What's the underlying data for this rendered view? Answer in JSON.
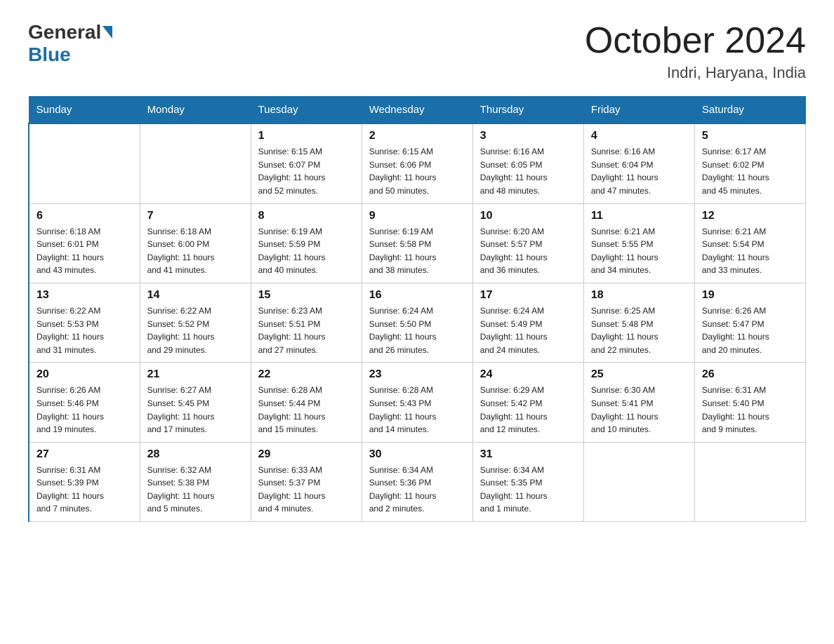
{
  "header": {
    "logo_general": "General",
    "logo_blue": "Blue",
    "month_title": "October 2024",
    "location": "Indri, Haryana, India"
  },
  "weekdays": [
    "Sunday",
    "Monday",
    "Tuesday",
    "Wednesday",
    "Thursday",
    "Friday",
    "Saturday"
  ],
  "weeks": [
    [
      {
        "day": "",
        "info": ""
      },
      {
        "day": "",
        "info": ""
      },
      {
        "day": "1",
        "info": "Sunrise: 6:15 AM\nSunset: 6:07 PM\nDaylight: 11 hours\nand 52 minutes."
      },
      {
        "day": "2",
        "info": "Sunrise: 6:15 AM\nSunset: 6:06 PM\nDaylight: 11 hours\nand 50 minutes."
      },
      {
        "day": "3",
        "info": "Sunrise: 6:16 AM\nSunset: 6:05 PM\nDaylight: 11 hours\nand 48 minutes."
      },
      {
        "day": "4",
        "info": "Sunrise: 6:16 AM\nSunset: 6:04 PM\nDaylight: 11 hours\nand 47 minutes."
      },
      {
        "day": "5",
        "info": "Sunrise: 6:17 AM\nSunset: 6:02 PM\nDaylight: 11 hours\nand 45 minutes."
      }
    ],
    [
      {
        "day": "6",
        "info": "Sunrise: 6:18 AM\nSunset: 6:01 PM\nDaylight: 11 hours\nand 43 minutes."
      },
      {
        "day": "7",
        "info": "Sunrise: 6:18 AM\nSunset: 6:00 PM\nDaylight: 11 hours\nand 41 minutes."
      },
      {
        "day": "8",
        "info": "Sunrise: 6:19 AM\nSunset: 5:59 PM\nDaylight: 11 hours\nand 40 minutes."
      },
      {
        "day": "9",
        "info": "Sunrise: 6:19 AM\nSunset: 5:58 PM\nDaylight: 11 hours\nand 38 minutes."
      },
      {
        "day": "10",
        "info": "Sunrise: 6:20 AM\nSunset: 5:57 PM\nDaylight: 11 hours\nand 36 minutes."
      },
      {
        "day": "11",
        "info": "Sunrise: 6:21 AM\nSunset: 5:55 PM\nDaylight: 11 hours\nand 34 minutes."
      },
      {
        "day": "12",
        "info": "Sunrise: 6:21 AM\nSunset: 5:54 PM\nDaylight: 11 hours\nand 33 minutes."
      }
    ],
    [
      {
        "day": "13",
        "info": "Sunrise: 6:22 AM\nSunset: 5:53 PM\nDaylight: 11 hours\nand 31 minutes."
      },
      {
        "day": "14",
        "info": "Sunrise: 6:22 AM\nSunset: 5:52 PM\nDaylight: 11 hours\nand 29 minutes."
      },
      {
        "day": "15",
        "info": "Sunrise: 6:23 AM\nSunset: 5:51 PM\nDaylight: 11 hours\nand 27 minutes."
      },
      {
        "day": "16",
        "info": "Sunrise: 6:24 AM\nSunset: 5:50 PM\nDaylight: 11 hours\nand 26 minutes."
      },
      {
        "day": "17",
        "info": "Sunrise: 6:24 AM\nSunset: 5:49 PM\nDaylight: 11 hours\nand 24 minutes."
      },
      {
        "day": "18",
        "info": "Sunrise: 6:25 AM\nSunset: 5:48 PM\nDaylight: 11 hours\nand 22 minutes."
      },
      {
        "day": "19",
        "info": "Sunrise: 6:26 AM\nSunset: 5:47 PM\nDaylight: 11 hours\nand 20 minutes."
      }
    ],
    [
      {
        "day": "20",
        "info": "Sunrise: 6:26 AM\nSunset: 5:46 PM\nDaylight: 11 hours\nand 19 minutes."
      },
      {
        "day": "21",
        "info": "Sunrise: 6:27 AM\nSunset: 5:45 PM\nDaylight: 11 hours\nand 17 minutes."
      },
      {
        "day": "22",
        "info": "Sunrise: 6:28 AM\nSunset: 5:44 PM\nDaylight: 11 hours\nand 15 minutes."
      },
      {
        "day": "23",
        "info": "Sunrise: 6:28 AM\nSunset: 5:43 PM\nDaylight: 11 hours\nand 14 minutes."
      },
      {
        "day": "24",
        "info": "Sunrise: 6:29 AM\nSunset: 5:42 PM\nDaylight: 11 hours\nand 12 minutes."
      },
      {
        "day": "25",
        "info": "Sunrise: 6:30 AM\nSunset: 5:41 PM\nDaylight: 11 hours\nand 10 minutes."
      },
      {
        "day": "26",
        "info": "Sunrise: 6:31 AM\nSunset: 5:40 PM\nDaylight: 11 hours\nand 9 minutes."
      }
    ],
    [
      {
        "day": "27",
        "info": "Sunrise: 6:31 AM\nSunset: 5:39 PM\nDaylight: 11 hours\nand 7 minutes."
      },
      {
        "day": "28",
        "info": "Sunrise: 6:32 AM\nSunset: 5:38 PM\nDaylight: 11 hours\nand 5 minutes."
      },
      {
        "day": "29",
        "info": "Sunrise: 6:33 AM\nSunset: 5:37 PM\nDaylight: 11 hours\nand 4 minutes."
      },
      {
        "day": "30",
        "info": "Sunrise: 6:34 AM\nSunset: 5:36 PM\nDaylight: 11 hours\nand 2 minutes."
      },
      {
        "day": "31",
        "info": "Sunrise: 6:34 AM\nSunset: 5:35 PM\nDaylight: 11 hours\nand 1 minute."
      },
      {
        "day": "",
        "info": ""
      },
      {
        "day": "",
        "info": ""
      }
    ]
  ]
}
